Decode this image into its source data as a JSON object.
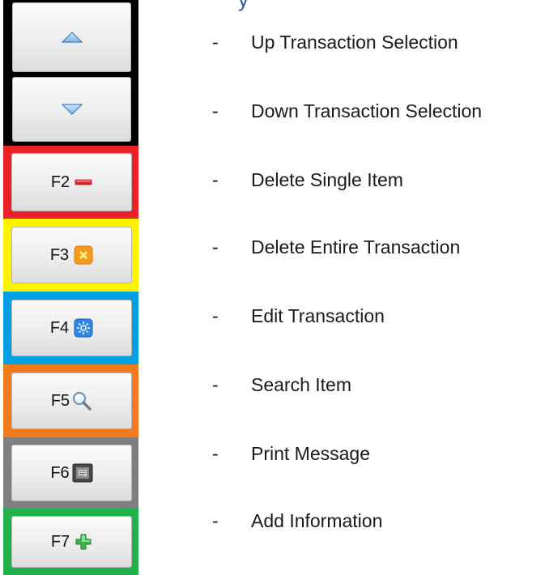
{
  "colors": {
    "nav_frame": "#000000",
    "f2_frame": "#ec2027",
    "f3_frame": "#fff200",
    "f4_frame": "#00a0e3",
    "f5_frame": "#f47a20",
    "f6_frame": "#7f7f7f",
    "f7_frame": "#22b04b"
  },
  "buttons": {
    "up": {
      "icon": "chevron-up-icon"
    },
    "down": {
      "icon": "chevron-down-icon"
    },
    "f2": {
      "key": "F2",
      "icon": "minus-icon"
    },
    "f3": {
      "key": "F3",
      "icon": "close-square-icon"
    },
    "f4": {
      "key": "F4",
      "icon": "edit-gear-icon"
    },
    "f5": {
      "key": "F5",
      "icon": "search-icon"
    },
    "f6": {
      "key": "F6",
      "icon": "printer-icon"
    },
    "f7": {
      "key": "F7",
      "icon": "plus-icon"
    }
  },
  "legend": [
    {
      "dash": "-",
      "text": "Up Transaction Selection"
    },
    {
      "dash": "-",
      "text": "Down Transaction Selection"
    },
    {
      "dash": "-",
      "text": "Delete Single Item"
    },
    {
      "dash": "-",
      "text": "Delete Entire Transaction"
    },
    {
      "dash": "-",
      "text": "Edit Transaction"
    },
    {
      "dash": "-",
      "text": "Search Item"
    },
    {
      "dash": "-",
      "text": "Print Message"
    },
    {
      "dash": "-",
      "text": "Add Information"
    }
  ]
}
